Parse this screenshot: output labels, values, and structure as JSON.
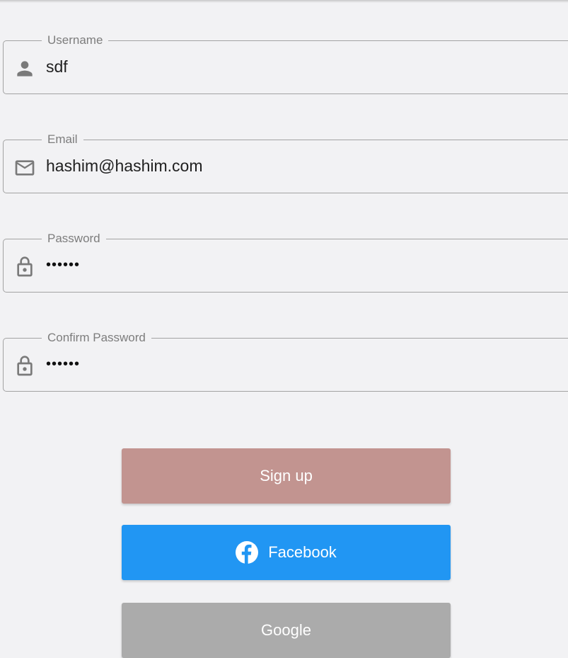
{
  "form": {
    "username": {
      "label": "Username",
      "value": "sdf",
      "icon": "person-icon"
    },
    "email": {
      "label": "Email",
      "value": "hashim@hashim.com",
      "icon": "mail-icon"
    },
    "password": {
      "label": "Password",
      "value": "••••••",
      "icon": "lock-icon"
    },
    "confirm_password": {
      "label": "Confirm Password",
      "value": "••••••",
      "icon": "lock-icon"
    }
  },
  "buttons": {
    "signup": {
      "label": "Sign up",
      "color": "#c29490"
    },
    "facebook": {
      "label": "Facebook",
      "color": "#2196f3",
      "icon": "facebook-icon"
    },
    "google": {
      "label": "Google",
      "color": "#ababab"
    }
  },
  "colors": {
    "background": "#f2f2f4",
    "field_border": "#a3a3a3",
    "label_text": "#7d7d7d",
    "icon_gray": "#7a7a7a"
  }
}
